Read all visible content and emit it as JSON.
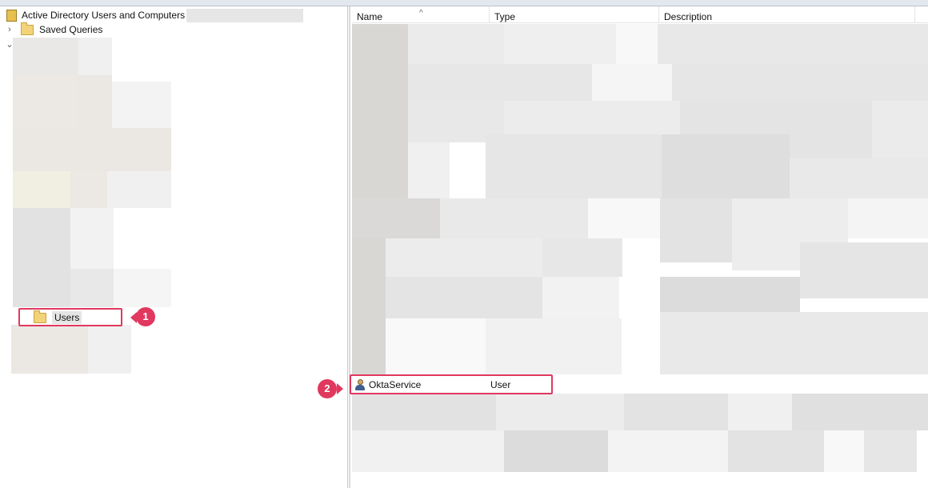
{
  "tree": {
    "root_label": "Active Directory Users and Computers",
    "saved_queries_label": "Saved Queries",
    "users_label": "Users"
  },
  "list": {
    "columns": [
      "Name",
      "Type",
      "Description"
    ],
    "highlighted_row": {
      "name": "OktaService",
      "type": "User"
    }
  },
  "callouts": [
    "1",
    "2"
  ],
  "colors": {
    "callout": "#e0385f",
    "folder": "#f2d379"
  },
  "icons": [
    "book-icon",
    "folder-icon",
    "user-icon",
    "chevron-right-icon",
    "chevron-down-icon",
    "sort-up-icon"
  ]
}
